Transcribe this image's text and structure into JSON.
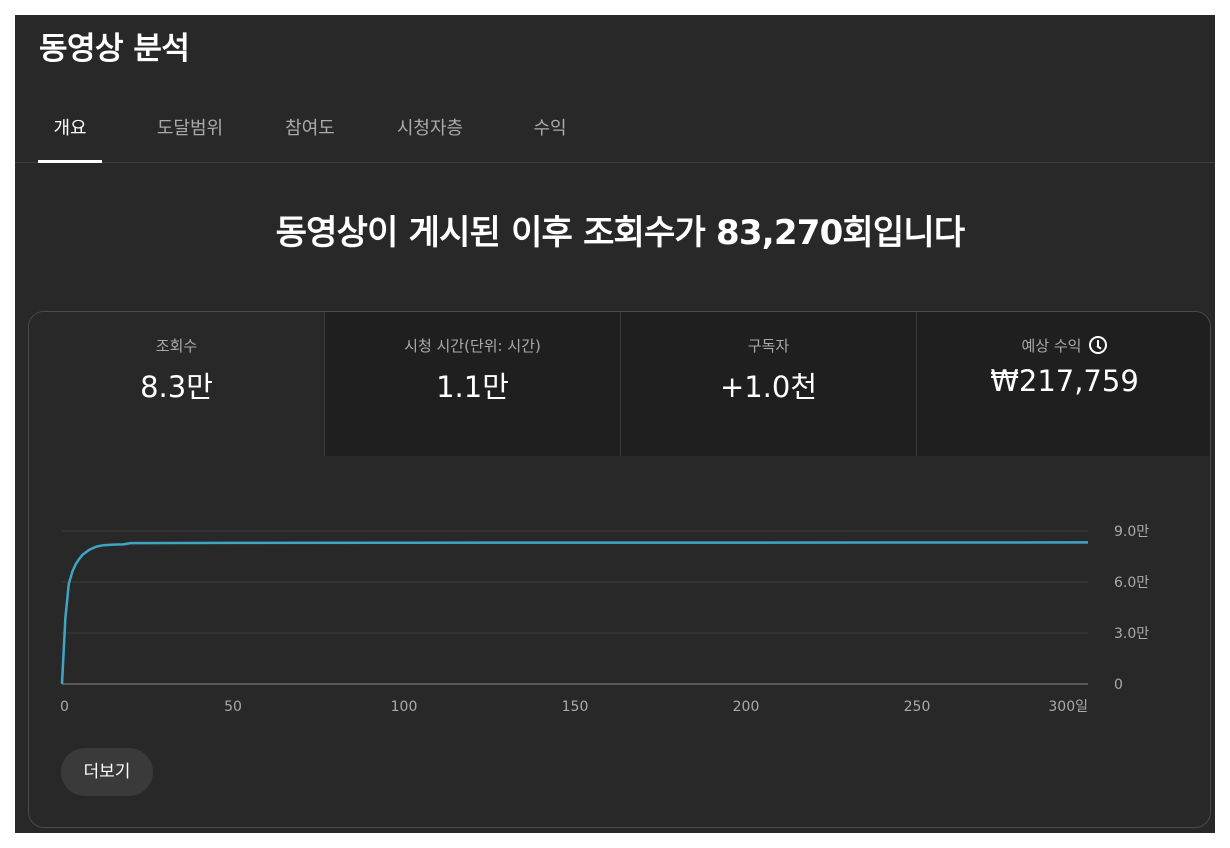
{
  "page_title": "동영상 분석",
  "tabs": [
    {
      "label": "개요",
      "active": true
    },
    {
      "label": "도달범위",
      "active": false
    },
    {
      "label": "참여도",
      "active": false
    },
    {
      "label": "시청자층",
      "active": false
    },
    {
      "label": "수익",
      "active": false
    }
  ],
  "headline": "동영상이 게시된 이후 조회수가 83,270회입니다",
  "metrics": [
    {
      "label": "조회수",
      "value": "8.3만"
    },
    {
      "label": "시청 시간(단위: 시간)",
      "value": "1.1만"
    },
    {
      "label": "구독자",
      "value": "+1.0천"
    },
    {
      "label": "예상 수익",
      "value": "₩217,759",
      "icon": "clock-icon"
    }
  ],
  "more_button": "더보기",
  "colors": {
    "background": "#282828",
    "line": "#3ea6c4",
    "text": "#ffffff",
    "muted": "#aaaaaa"
  },
  "chart_data": {
    "type": "line",
    "series": [
      {
        "x": [
          0,
          1,
          2,
          3,
          4,
          5,
          6,
          8,
          10,
          12,
          15,
          18,
          20,
          50,
          100,
          150,
          200,
          250,
          300
        ],
        "values": [
          0,
          39000,
          59000,
          66000,
          70500,
          73500,
          76000,
          79000,
          80800,
          81600,
          82000,
          82100,
          82900,
          83000,
          83100,
          83150,
          83200,
          83250,
          83270
        ]
      }
    ],
    "x_ticks": [
      "0",
      "50",
      "100",
      "150",
      "200",
      "250",
      "300일"
    ],
    "x_tick_values": [
      0,
      50,
      100,
      150,
      200,
      250,
      300
    ],
    "y_ticks": [
      "0",
      "3.0만",
      "6.0만",
      "9.0만"
    ],
    "y_tick_values": [
      0,
      30000,
      60000,
      90000
    ],
    "xlim": [
      0,
      300
    ],
    "ylim": [
      0,
      90000
    ],
    "grid": true
  }
}
